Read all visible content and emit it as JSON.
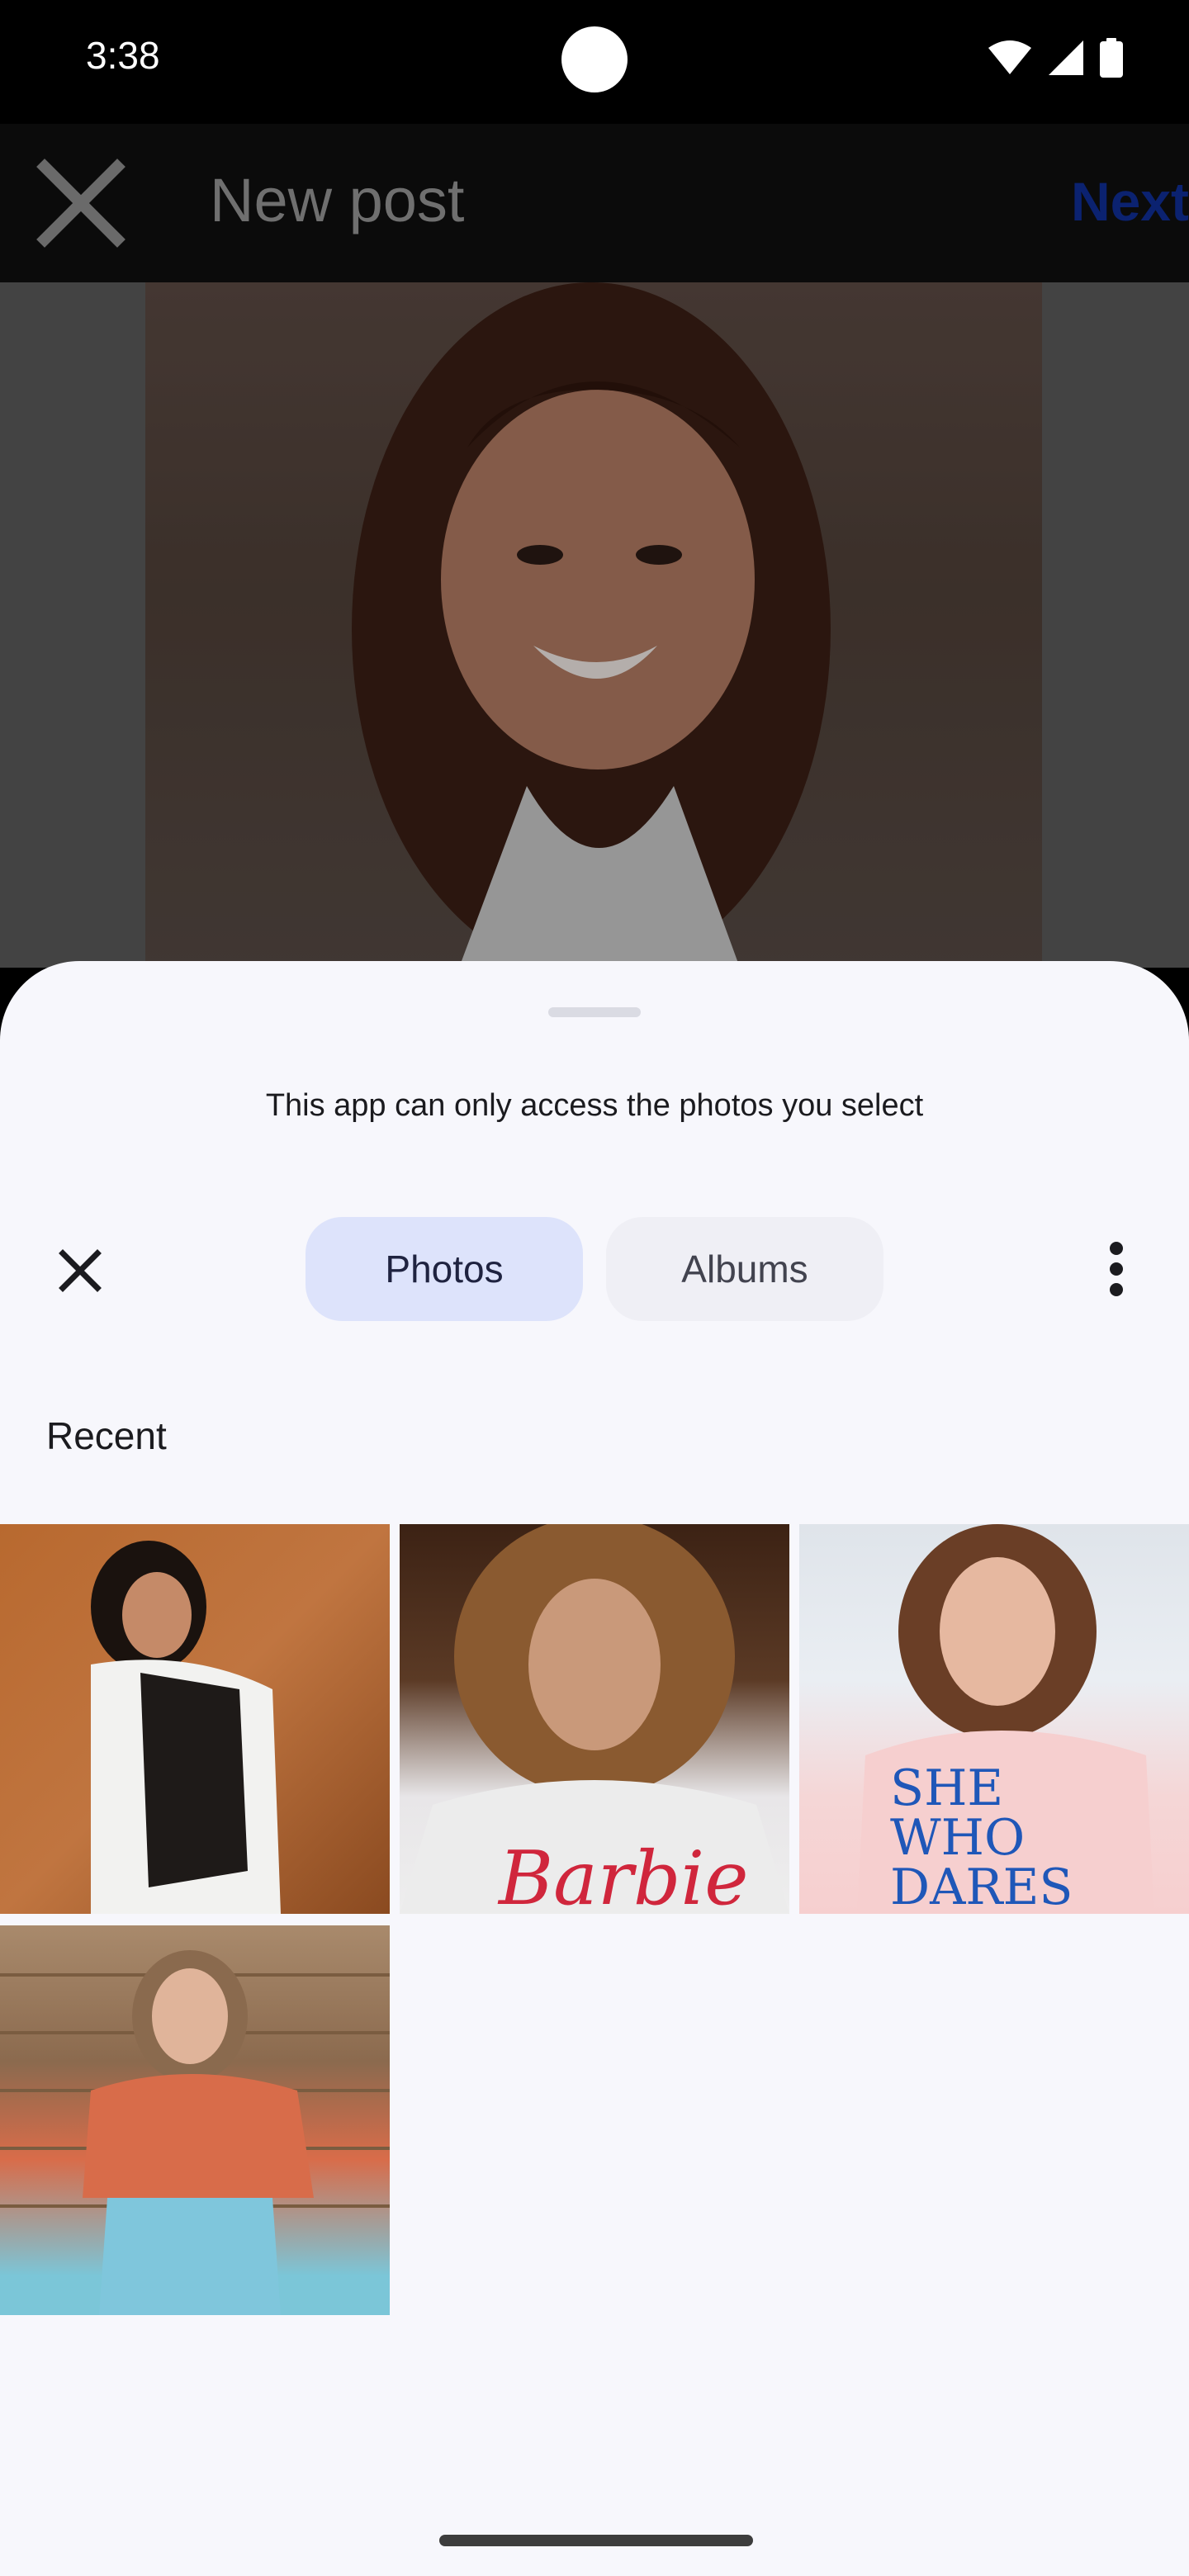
{
  "status_bar": {
    "time": "3:38"
  },
  "app_bar": {
    "title": "New post",
    "next_label": "Next"
  },
  "picker": {
    "notice": "This app can only access the photos you select",
    "tabs": [
      {
        "label": "Photos",
        "selected": true
      },
      {
        "label": "Albums",
        "selected": false
      }
    ],
    "section_title": "Recent",
    "thumbnails": [
      {
        "description": "photo"
      },
      {
        "description": "photo"
      },
      {
        "description": "photo"
      },
      {
        "description": "photo"
      }
    ]
  },
  "colors": {
    "selected_tab_bg": "#dde3fb",
    "unselected_tab_bg": "#efeff5",
    "sheet_bg": "#f7f7fc",
    "next_color": "#0b2270"
  }
}
